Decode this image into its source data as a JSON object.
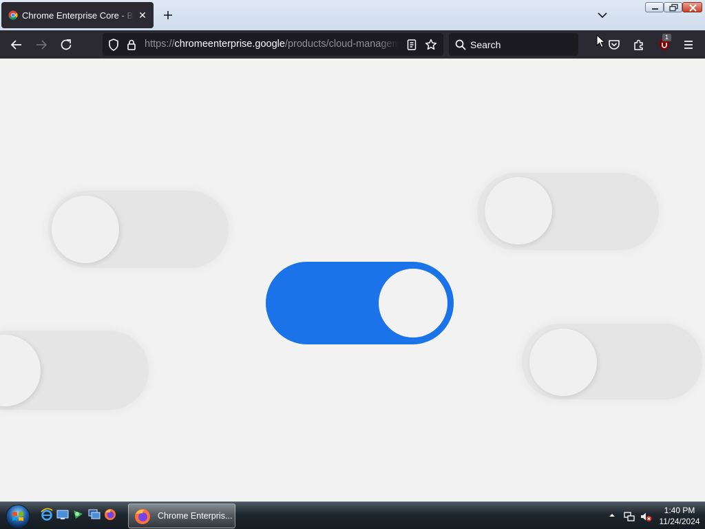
{
  "browser": {
    "tab": {
      "title": "Chrome Enterprise Core - Browser Management",
      "close_glyph": "✕",
      "favicon": "chrome-icon"
    },
    "new_tab_glyph": "+",
    "url": {
      "scheme": "https://",
      "host": "chromeenterprise.google",
      "path": "/products/cloud-management/"
    },
    "search": {
      "placeholder": "Search"
    },
    "extensions_badge": "1"
  },
  "page": {
    "toggles": [
      {
        "state": "off"
      },
      {
        "state": "off"
      },
      {
        "state": "on"
      },
      {
        "state": "off"
      },
      {
        "state": "off"
      }
    ],
    "accent_color": "#1a73e8"
  },
  "taskbar": {
    "active_window": "Chrome Enterpris...",
    "clock": {
      "time": "1:40 PM",
      "date": "11/24/2024"
    }
  }
}
